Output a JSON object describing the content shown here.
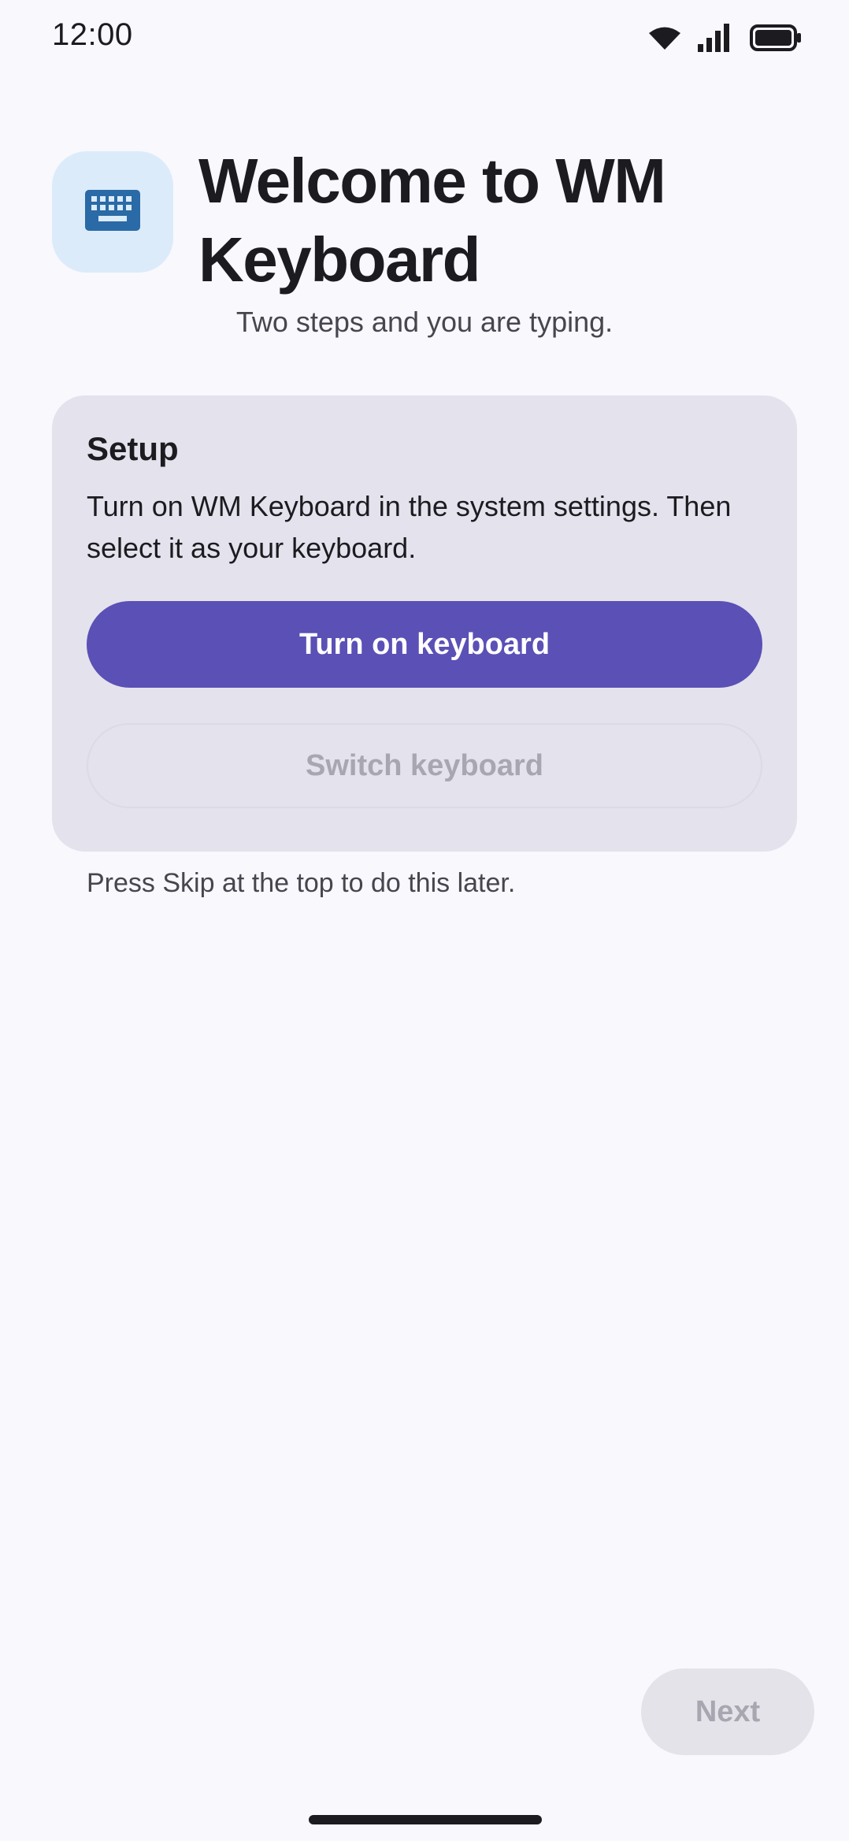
{
  "status_bar": {
    "time": "12:00",
    "icons": [
      "wifi-icon",
      "cellular-signal-icon",
      "battery-icon"
    ]
  },
  "header": {
    "app_icon": "keyboard-icon",
    "title": "Welcome to WM Keyboard",
    "subtitle": "Two steps and you are typing."
  },
  "setup_card": {
    "title": "Setup",
    "description": "Turn on WM Keyboard in the system settings. Then select it as your keyboard.",
    "primary_button_label": "Turn on keyboard",
    "secondary_button_label": "Switch keyboard",
    "secondary_button_enabled": false
  },
  "hint": "Press Skip at the top to do this later.",
  "footer": {
    "next_label": "Next",
    "next_enabled": false
  },
  "colors": {
    "background": "#f8f8fd",
    "card": "#e4e2ec",
    "accent": "#5a50b6",
    "icon_tile": "#dcebfa",
    "icon_glyph": "#2a6aa6",
    "disabled_text": "#a8a6b0"
  }
}
